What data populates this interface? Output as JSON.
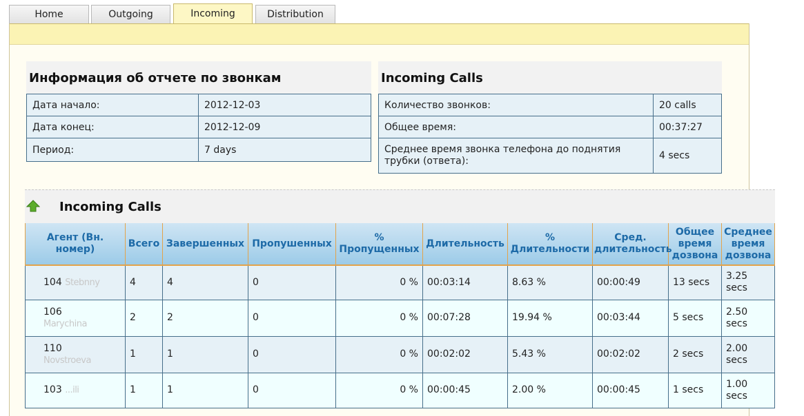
{
  "tabs": [
    {
      "label": "Home"
    },
    {
      "label": "Outgoing"
    },
    {
      "label": "Incoming",
      "active": true
    },
    {
      "label": "Distribution"
    }
  ],
  "report_info": {
    "title": "Информация об отчете по звонкам",
    "rows": [
      {
        "label": "Дата начало:",
        "value": "2012-12-03"
      },
      {
        "label": "Дата конец:",
        "value": "2012-12-09"
      },
      {
        "label": "Период:",
        "value": "7 days"
      }
    ]
  },
  "incoming_summary": {
    "title": "Incoming Calls",
    "rows": [
      {
        "label": "Количество звонков:",
        "value": "20 calls"
      },
      {
        "label": "Общее время:",
        "value": "00:37:27"
      },
      {
        "label": "Среднее время звонка телефона до поднятия трубки (ответа):",
        "value": "4 secs"
      }
    ]
  },
  "incoming_table": {
    "title": "Incoming Calls",
    "columns": [
      "Агент (Вн. номер)",
      "Всего",
      "Завершенных",
      "Пропушенных",
      "% Пропущенных",
      "Длительность",
      "% Длительности",
      "Сред. длительность",
      "Общее время дозвона",
      "Среднее время дозвона"
    ],
    "rows": [
      {
        "agent": "104",
        "agent_name": "Stebnny",
        "total": "4",
        "completed": "4",
        "missed": "0",
        "missed_pct": "0 %",
        "duration": "00:03:14",
        "duration_pct": "8.63 %",
        "avg_duration": "00:00:49",
        "total_ring": "13 secs",
        "avg_ring": "3.25 secs"
      },
      {
        "agent": "106",
        "agent_name": "Marychina",
        "total": "2",
        "completed": "2",
        "missed": "0",
        "missed_pct": "0 %",
        "duration": "00:07:28",
        "duration_pct": "19.94 %",
        "avg_duration": "00:03:44",
        "total_ring": "5 secs",
        "avg_ring": "2.50 secs"
      },
      {
        "agent": "110",
        "agent_name": "Novstroeva",
        "total": "1",
        "completed": "1",
        "missed": "0",
        "missed_pct": "0 %",
        "duration": "00:02:02",
        "duration_pct": "5.43 %",
        "avg_duration": "00:02:02",
        "total_ring": "2 secs",
        "avg_ring": "2.00 secs"
      },
      {
        "agent": "103",
        "agent_name": "...ili",
        "total": "1",
        "completed": "1",
        "missed": "0",
        "missed_pct": "0 %",
        "duration": "00:00:45",
        "duration_pct": "2.00 %",
        "avg_duration": "00:00:45",
        "total_ring": "1 secs",
        "avg_ring": "1.00 secs"
      }
    ]
  },
  "colors": {
    "accent_orange": "#e06a1a",
    "header_blue": "#1d6aa7",
    "band_yellow": "#fbf3b4",
    "grid_border": "#466e8a"
  },
  "icons": {
    "sort_arrow": "green-up-arrow-icon"
  }
}
